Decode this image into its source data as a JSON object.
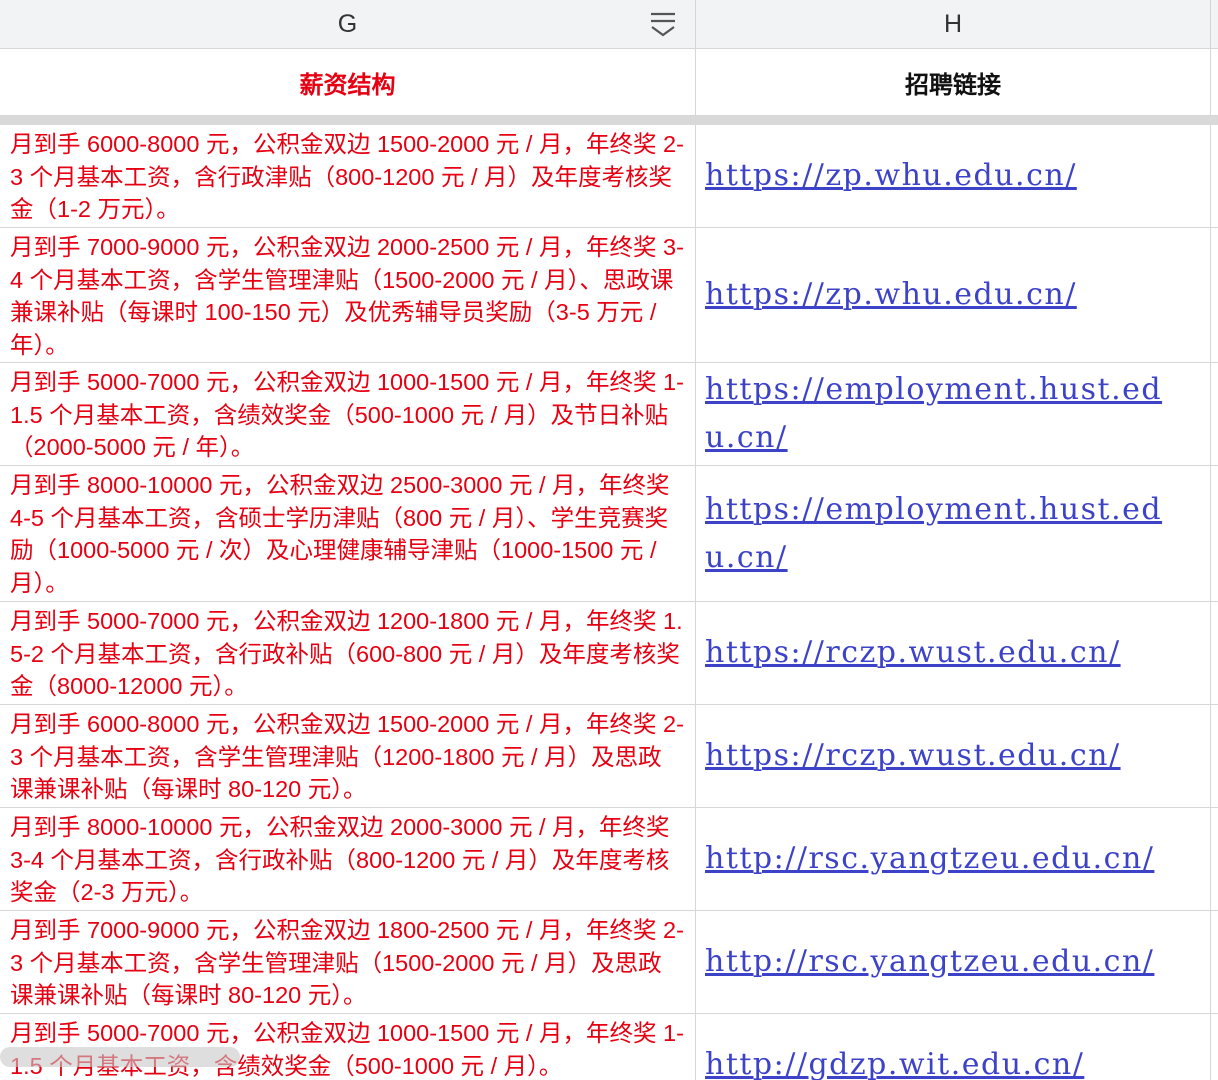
{
  "columns": {
    "g": "G",
    "h": "H"
  },
  "header": {
    "g": "薪资结构",
    "h": "招聘链接",
    "g_color": "#e60012",
    "h_color": "#111111"
  },
  "icons": {
    "filter": "filter-icon"
  },
  "rows": [
    {
      "salary": "月到手 6000-8000 元，公积金双边 1500-2000 元 / 月，年终奖 2-3 个月基本工资，含行政津贴（800-1200 元 / 月）及年度考核奖金（1-2 万元）。",
      "link": "https://zp.whu.edu.cn/"
    },
    {
      "salary": "月到手 7000-9000 元，公积金双边 2000-2500 元 / 月，年终奖 3-4 个月基本工资，含学生管理津贴（1500-2000 元 / 月）、思政课兼课补贴（每课时 100-150 元）及优秀辅导员奖励（3-5 万元 / 年）。",
      "link": "https://zp.whu.edu.cn/"
    },
    {
      "salary": "月到手 5000-7000 元，公积金双边 1000-1500 元 / 月，年终奖 1-1.5 个月基本工资，含绩效奖金（500-1000 元 / 月）及节日补贴（2000-5000 元 / 年）。",
      "link": "https://employment.hust.edu.cn/"
    },
    {
      "salary": "月到手 8000-10000 元，公积金双边 2500-3000 元 / 月，年终奖 4-5 个月基本工资，含硕士学历津贴（800 元 / 月）、学生竞赛奖励（1000-5000 元 / 次）及心理健康辅导津贴（1000-1500 元 / 月）。",
      "link": "https://employment.hust.edu.cn/"
    },
    {
      "salary": "月到手 5000-7000 元，公积金双边 1200-1800 元 / 月，年终奖 1.5-2 个月基本工资，含行政补贴（600-800 元 / 月）及年度考核奖金（8000-12000 元）。",
      "link": "https://rczp.wust.edu.cn/"
    },
    {
      "salary": "月到手 6000-8000 元，公积金双边 1500-2000 元 / 月，年终奖 2-3 个月基本工资，含学生管理津贴（1200-1800 元 / 月）及思政课兼课补贴（每课时 80-120 元）。",
      "link": "https://rczp.wust.edu.cn/"
    },
    {
      "salary": "月到手 8000-10000 元，公积金双边 2000-3000 元 / 月，年终奖 3-4 个月基本工资，含行政补贴（800-1200 元 / 月）及年度考核奖金（2-3 万元）。",
      "link": "http://rsc.yangtzeu.edu.cn/"
    },
    {
      "salary": "月到手 7000-9000 元，公积金双边 1800-2500 元 / 月，年终奖 2-3 个月基本工资，含学生管理津贴（1500-2000 元 / 月）及思政课兼课补贴（每课时 80-120 元）。",
      "link": "http://rsc.yangtzeu.edu.cn/"
    },
    {
      "salary": "月到手 5000-7000 元，公积金双边 1000-1500 元 / 月，年终奖 1-1.5 个月基本工资，含绩效奖金（500-1000 元 / 月）。",
      "link": "http://gdzp.wit.edu.cn/"
    }
  ]
}
